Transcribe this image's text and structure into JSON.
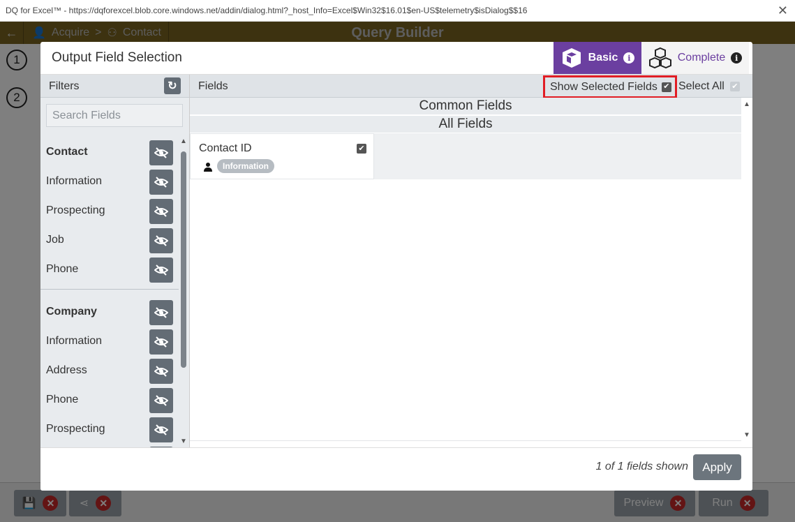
{
  "window": {
    "title": "DQ for Excel™ - https://dqforexcel.blob.core.windows.net/addin/dialog.html?_host_Info=Excel$Win32$16.01$en-US$telemetry$isDialog$$16"
  },
  "app": {
    "breadcrumb": [
      "Acquire",
      ">",
      "Contact"
    ],
    "header_title": "Query Builder",
    "steps": [
      "1",
      "2"
    ],
    "footer": {
      "preview_label": "Preview",
      "run_label": "Run"
    }
  },
  "modal": {
    "title": "Output Field Selection",
    "toggle": {
      "basic_label": "Basic",
      "complete_label": "Complete",
      "active": "Basic"
    },
    "filters": {
      "header": "Filters",
      "search_placeholder": "Search Fields",
      "groups": [
        {
          "name": "Contact",
          "items": [
            "Information",
            "Prospecting",
            "Job",
            "Phone"
          ]
        },
        {
          "name": "Company",
          "items": [
            "Information",
            "Address",
            "Phone",
            "Prospecting"
          ]
        }
      ]
    },
    "fields": {
      "header": "Fields",
      "show_selected_label": "Show Selected Fields",
      "show_selected_checked": true,
      "select_all_label": "Select All",
      "select_all_checked": true,
      "sections": [
        "Common Fields",
        "All Fields"
      ],
      "items": [
        {
          "name": "Contact ID",
          "checked": true,
          "tag": "Information"
        }
      ]
    },
    "footer": {
      "count_text": "1 of 1 fields shown",
      "apply_label": "Apply"
    }
  },
  "colors": {
    "accent_purple": "#6b3fa0",
    "header_gold": "#7a6420",
    "highlight_red": "#e11d24",
    "button_gray": "#636c75"
  }
}
